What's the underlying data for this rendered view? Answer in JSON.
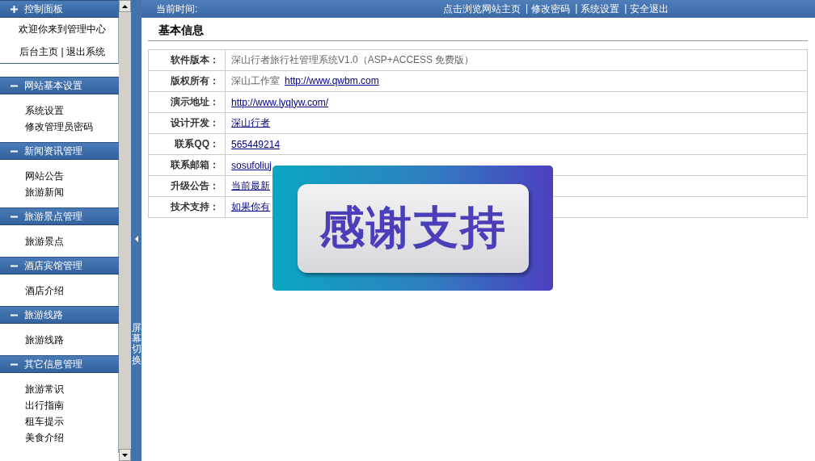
{
  "sidebar": {
    "sections": [
      {
        "title": "控制面板",
        "expanded": false,
        "kind": "info",
        "items": [
          "欢迎你来到管理中心",
          "后台主页 | 退出系统"
        ]
      },
      {
        "title": "网站基本设置",
        "expanded": true,
        "kind": "menu",
        "items": [
          "系统设置",
          "修改管理员密码"
        ]
      },
      {
        "title": "新闻资讯管理",
        "expanded": true,
        "kind": "menu",
        "items": [
          "网站公告",
          "旅游新闻"
        ]
      },
      {
        "title": "旅游景点管理",
        "expanded": true,
        "kind": "menu",
        "items": [
          "旅游景点"
        ]
      },
      {
        "title": "酒店宾馆管理",
        "expanded": true,
        "kind": "menu",
        "items": [
          "酒店介绍"
        ]
      },
      {
        "title": "旅游线路",
        "expanded": true,
        "kind": "menu",
        "items": [
          "旅游线路"
        ]
      },
      {
        "title": "其它信息管理",
        "expanded": true,
        "kind": "menu",
        "items": [
          "旅游常识",
          "出行指南",
          "租车提示",
          "美食介绍"
        ]
      }
    ]
  },
  "toggle_bar": {
    "label": "屏幕切换"
  },
  "top_bar": {
    "time_label": "当前时间:",
    "separator": "|",
    "links": [
      "点击浏览网站主页",
      "修改密码",
      "系统设置",
      "安全退出"
    ]
  },
  "content": {
    "title": "基本信息",
    "rows": [
      {
        "label": "软件版本：",
        "value": [
          {
            "text": "深山行者旅行社管理系统V1.0（ASP+ACCESS 免费版）",
            "link": false
          }
        ]
      },
      {
        "label": "版权所有：",
        "value": [
          {
            "text": "深山工作室",
            "link": false
          },
          {
            "text": "http://www.qwbm.com",
            "link": true
          }
        ]
      },
      {
        "label": "演示地址：",
        "value": [
          {
            "text": "http://www.lyqlyw.com/",
            "link": true
          }
        ]
      },
      {
        "label": "设计开发：",
        "value": [
          {
            "text": "深山行者",
            "link": true
          }
        ]
      },
      {
        "label": "联系QQ：",
        "value": [
          {
            "text": "565449214",
            "link": true
          }
        ]
      },
      {
        "label": "联系邮箱：",
        "value": [
          {
            "text": "sosufoliuj",
            "link": true
          }
        ]
      },
      {
        "label": "升级公告：",
        "value": [
          {
            "text": "当前最新",
            "link": true
          }
        ]
      },
      {
        "label": "技术支持：",
        "value": [
          {
            "text": "如果你有",
            "link": true
          }
        ]
      }
    ]
  },
  "popup": {
    "text": "感谢支持"
  }
}
